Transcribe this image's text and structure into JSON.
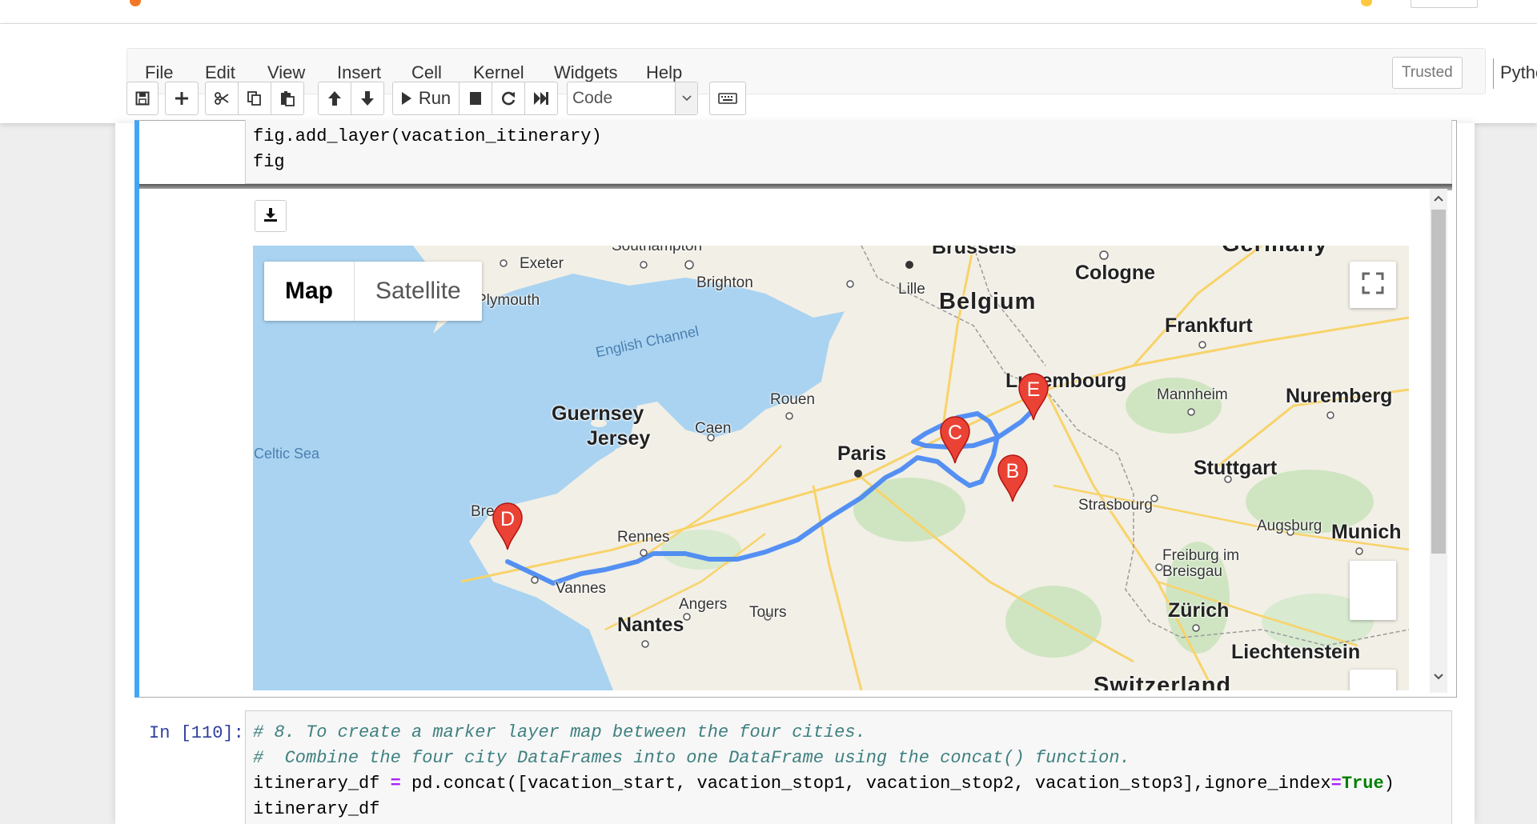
{
  "menubar": {
    "items": [
      "File",
      "Edit",
      "View",
      "Insert",
      "Cell",
      "Kernel",
      "Widgets",
      "Help"
    ],
    "trusted": "Trusted",
    "kernel": "PythonData"
  },
  "toolbar": {
    "run_label": "Run",
    "cell_type": "Code",
    "icons": [
      "save-icon",
      "plus-icon",
      "cut-icon",
      "copy-icon",
      "paste-icon",
      "arrow-up-icon",
      "arrow-down-icon",
      "run-icon",
      "stop-icon",
      "restart-icon",
      "fast-forward-icon",
      "keyboard-icon"
    ]
  },
  "cell1": {
    "lines": [
      "fig.add_layer(vacation_itinerary)",
      "fig"
    ]
  },
  "map": {
    "types": [
      "Map",
      "Satellite"
    ],
    "labels": {
      "southampton": "Southampton",
      "brussels": "Brussels",
      "germany": "Germany",
      "exeter": "Exeter",
      "brighton": "Brighton",
      "lille": "Lille",
      "belgium": "Belgium",
      "cologne": "Cologne",
      "plymouth": "Plymouth",
      "frankfurt": "Frankfurt",
      "english_channel": "English Channel",
      "luxembourg": "Luxembourg",
      "mannheim": "Mannheim",
      "nuremberg": "Nuremberg",
      "rouen": "Rouen",
      "guernsey": "Guernsey",
      "jersey": "Jersey",
      "caen": "Caen",
      "paris": "Paris",
      "celtic_sea": "Celtic Sea",
      "stuttgart": "Stuttgart",
      "strasbourg": "Strasbourg",
      "brest": "Brest",
      "rennes": "Rennes",
      "augsburg": "Augsburg",
      "munich": "Munich",
      "freiburg": "Freiburg im Breisgau",
      "vannes": "Vannes",
      "angers": "Angers",
      "tours": "Tours",
      "zurich": "Zürich",
      "nantes": "Nantes",
      "liechtenstein": "Liechtenstein",
      "switzerland": "Switzerland"
    },
    "markers": [
      "B",
      "C",
      "D",
      "E"
    ],
    "route_color": "#4285f4",
    "marker_color": "#ea4335"
  },
  "cell2": {
    "prompt": "In [110]:",
    "comment1": "# 8. To create a marker layer map between the four cities.",
    "comment2": "#  Combine the four city DataFrames into one DataFrame using the concat() function.",
    "line3_a": "itinerary_df ",
    "line3_eq": "=",
    "line3_b": " pd.concat([vacation_start, vacation_stop1, vacation_stop2, vacation_stop3],ignore_index",
    "line3_eq2": "=",
    "line3_kw": "True",
    "line3_c": ")",
    "line4": "itinerary_df"
  }
}
